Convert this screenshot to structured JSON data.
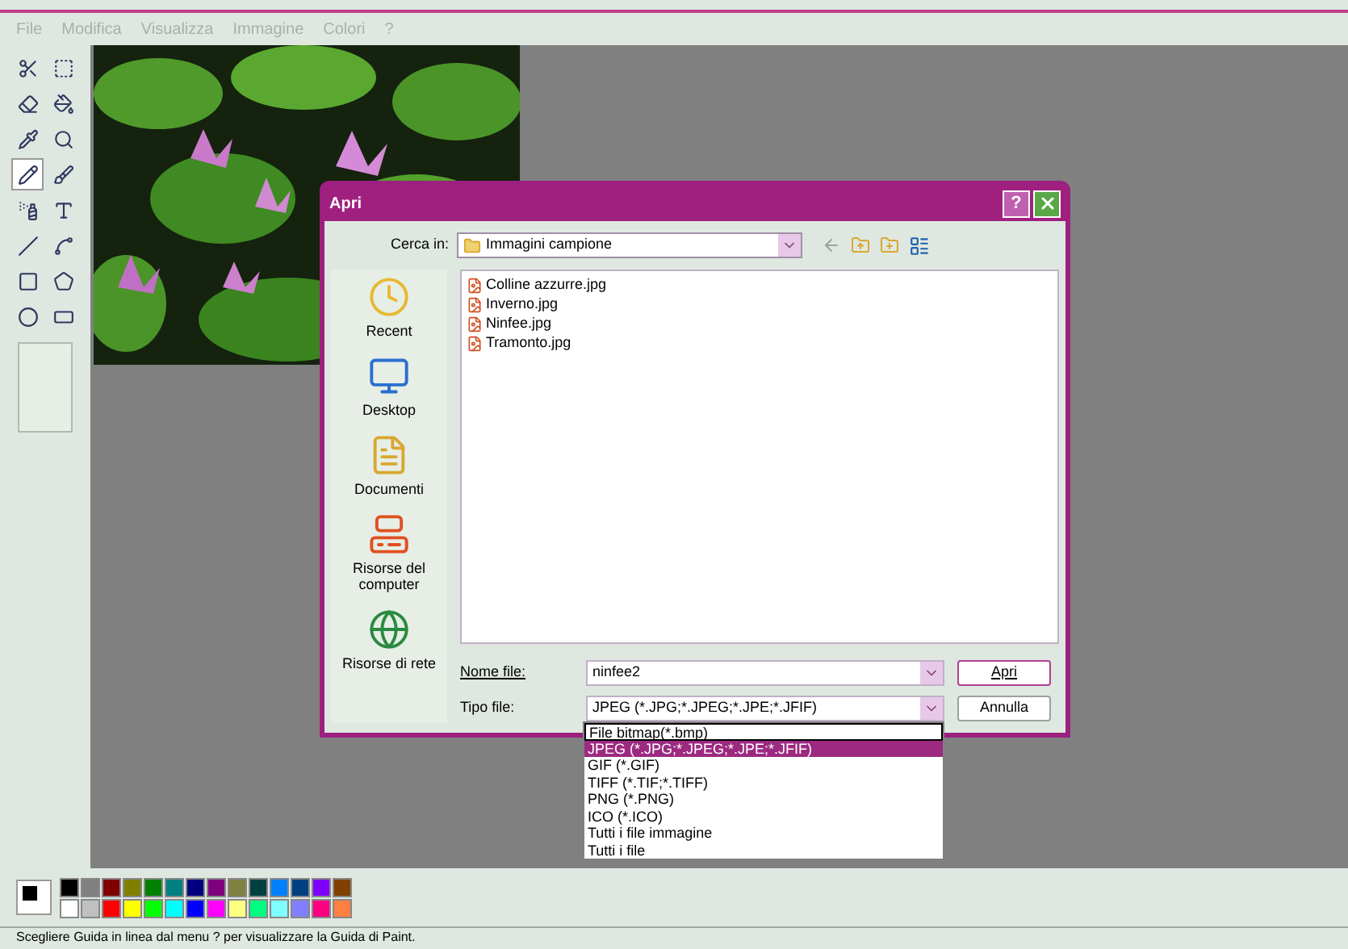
{
  "menu": [
    "File",
    "Modifica",
    "Visualizza",
    "Immagine",
    "Colori",
    "?"
  ],
  "tools": [
    {
      "selected": false
    },
    {
      "selected": false
    },
    {
      "selected": false
    },
    {
      "selected": false
    },
    {
      "selected": false
    },
    {
      "selected": false
    },
    {
      "selected": true
    },
    {
      "selected": false
    },
    {
      "selected": false
    },
    {
      "selected": false
    },
    {
      "selected": false
    },
    {
      "selected": false
    },
    {
      "selected": false
    },
    {
      "selected": false
    },
    {
      "selected": false
    },
    {
      "selected": false
    }
  ],
  "palette": [
    {
      "color": "#000000"
    },
    {
      "color": "#808080"
    },
    {
      "color": "#800000"
    },
    {
      "color": "#808000"
    },
    {
      "color": "#008000"
    },
    {
      "color": "#008080"
    },
    {
      "color": "#000080"
    },
    {
      "color": "#800080"
    },
    {
      "color": "#808040"
    },
    {
      "color": "#004040"
    },
    {
      "color": "#0080ff"
    },
    {
      "color": "#004080"
    },
    {
      "color": "#8000ff"
    },
    {
      "color": "#804000"
    },
    {
      "color": "#ffffff"
    },
    {
      "color": "#c0c0c0"
    },
    {
      "color": "#ff0000"
    },
    {
      "color": "#ffff00"
    },
    {
      "color": "#00ff00"
    },
    {
      "color": "#00ffff"
    },
    {
      "color": "#0000ff"
    },
    {
      "color": "#ff00ff"
    },
    {
      "color": "#ffff80"
    },
    {
      "color": "#00ff80"
    },
    {
      "color": "#80ffff"
    },
    {
      "color": "#8080ff"
    },
    {
      "color": "#ff0080"
    },
    {
      "color": "#ff8040"
    }
  ],
  "dialog": {
    "title": "Apri",
    "help": "?",
    "look_in_label": "Cerca in:",
    "look_in": "Immagini campione",
    "places": [
      "Recent",
      "Desktop",
      "Documenti",
      "Risorse del computer",
      "Risorse di rete"
    ],
    "files": [
      "Colline azzurre.jpg",
      "Inverno.jpg",
      "Ninfee.jpg",
      "Tramonto.jpg"
    ],
    "file_name_label": "Nome file:",
    "file_name": "ninfee2",
    "file_type_label": "Tipo file:",
    "file_type": "JPEG (*.JPG;*.JPEG;*.JPE;*.JFIF)",
    "buttons": [
      "Apri",
      "Annulla"
    ],
    "file_type_options": [
      {
        "label": "File bitmap(*.bmp)",
        "selected": false
      },
      {
        "label": "JPEG (*.JPG;*.JPEG;*.JPE;*.JFIF)",
        "selected": true
      },
      {
        "label": "GIF (*.GIF)",
        "selected": false
      },
      {
        "label": "TIFF (*.TIF;*.TIFF)",
        "selected": false
      },
      {
        "label": "PNG (*.PNG)",
        "selected": false
      },
      {
        "label": "ICO (*.ICO)",
        "selected": false
      },
      {
        "label": "Tutti i file immagine",
        "selected": false
      },
      {
        "label": "Tutti i file",
        "selected": false
      }
    ]
  },
  "status_bar": "Scegliere Guida in linea dal menu ? per visualizzare la Guida di Paint."
}
